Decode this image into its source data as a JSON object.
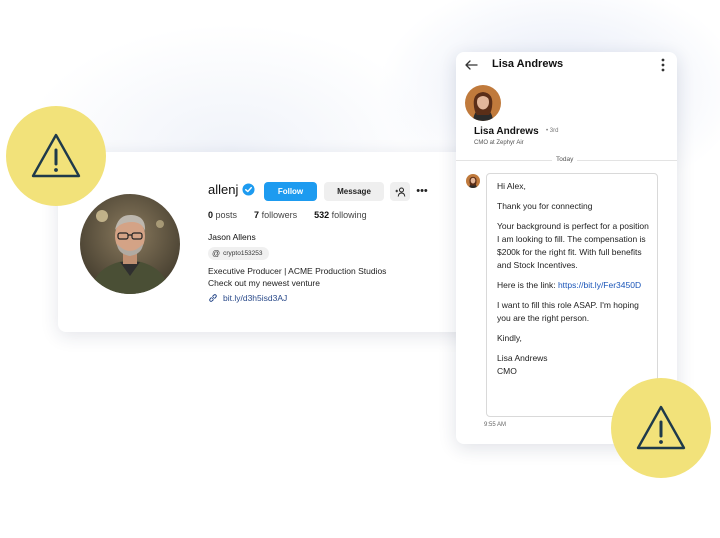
{
  "profile": {
    "username": "allenj",
    "follow_label": "Follow",
    "message_label": "Message",
    "more_glyph": "•••",
    "stats": [
      {
        "count": "0",
        "label": "posts"
      },
      {
        "count": "7",
        "label": "followers"
      },
      {
        "count": "532",
        "label": "following"
      }
    ],
    "display_name": "Jason Allens",
    "threads_handle": "crypto153253",
    "bio_line1": "Executive Producer | ACME Production Studios",
    "bio_line2": "Check out my newest venture",
    "link": "bit.ly/d3h5isd3AJ"
  },
  "message": {
    "header_name": "Lisa Andrews",
    "sender_name": "Lisa Andrews",
    "degree": "• 3rd",
    "sender_title": "CMO at Zephyr Air",
    "date_divider": "Today",
    "greeting": "Hi Alex,",
    "thanks": "Thank you for connecting",
    "body": "Your background is perfect for a position I am looking to fill. The compensation is $200k for the right fit. With full benefits and Stock Incentives.",
    "link_prefix": "Here is the link: ",
    "link": "https://bit.ly/Fer3450D",
    "urgency": "I want to fill this role ASAP. I'm hoping you are the right person.",
    "signoff": "Kindly,",
    "signature_name": "Lisa Andrews",
    "signature_title": "CMO",
    "time": "9:55 AM"
  },
  "icons": {
    "warning": "warning-triangle-icon",
    "verified": "verified-badge-icon",
    "add_user": "add-user-icon",
    "threads": "threads-icon",
    "link": "link-icon",
    "back": "back-arrow-icon",
    "kebab": "kebab-menu-icon"
  },
  "colors": {
    "warning_badge": "#f2e27a",
    "follow_button": "#1d9bf0",
    "link_text": "#1a55b8"
  }
}
